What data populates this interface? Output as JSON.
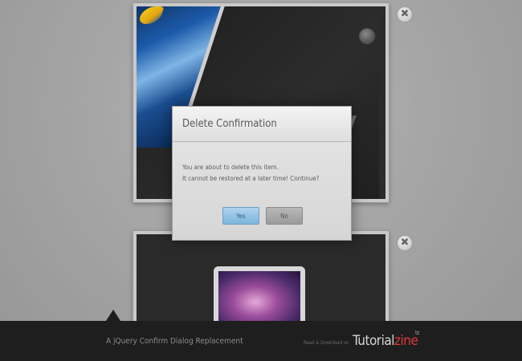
{
  "dialog": {
    "title": "Delete Confirmation",
    "message_line1": "You are about to delete this item.",
    "message_line2": "It cannot be restored at a later time! Continue?",
    "yes_label": "Yes",
    "no_label": "No"
  },
  "items": {
    "close_glyph": "✖",
    "partial_text": "V"
  },
  "footer": {
    "title": "A jQuery Confirm Dialog Replacement",
    "credit": "Read & Download on",
    "logo_main": "Tutorial",
    "logo_accent": "zine",
    "logo_sup": "tz"
  },
  "colors": {
    "yes_button": "#8fc2e6",
    "logo_accent": "#e23838",
    "footer_bg": "#1e1e1e"
  }
}
